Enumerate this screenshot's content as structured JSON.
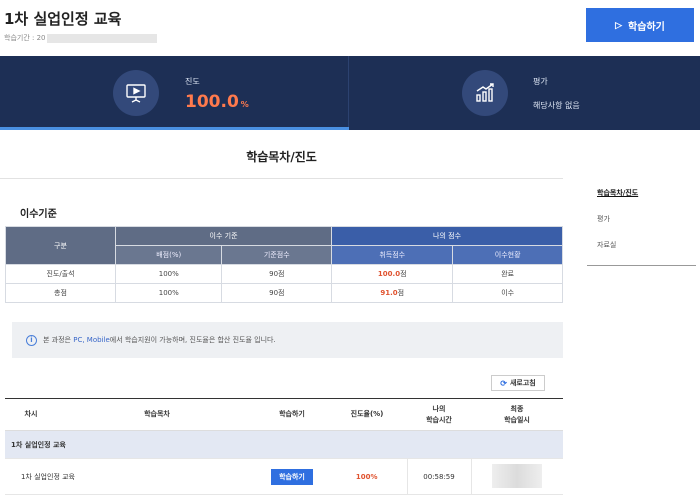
{
  "header": {
    "title": "1차 실업인정 교육",
    "period_label": "학습기간 : 20",
    "start_button": "학습하기"
  },
  "stats": {
    "progress_label": "진도",
    "progress_value": "100.0",
    "progress_unit": "%",
    "grade_label": "평가",
    "grade_value": "해당사항 없음"
  },
  "main": {
    "title": "학습목차/진도",
    "section_title": "이수기준"
  },
  "side_menu": [
    {
      "label": "학습목차/진도",
      "active": true
    },
    {
      "label": "평가",
      "active": false
    },
    {
      "label": "자료실",
      "active": false
    }
  ],
  "criteria": {
    "col_group": "구분",
    "group_standard": "이수 기준",
    "group_mine": "나의 점수",
    "sub_weight": "배점(%)",
    "sub_base": "기준점수",
    "sub_acquired": "취득점수",
    "sub_status": "이수현황",
    "rows": [
      {
        "name": "진도/출석",
        "weight": "100%",
        "base": "90점",
        "acquired_num": "100.0",
        "acquired_unit": "점",
        "status": "완료"
      },
      {
        "name": "총점",
        "weight": "100%",
        "base": "90점",
        "acquired_num": "91.0",
        "acquired_unit": "점",
        "status": "이수"
      }
    ]
  },
  "notice": {
    "prefix": "본 과정은 ",
    "highlight": "PC, Mobile",
    "suffix": " 에서 학습지원이 가능하며, 진도율은 합산 진도율 입니다."
  },
  "refresh_label": "새로고침",
  "list": {
    "headers": [
      "차시",
      "학습목차",
      "학습하기",
      "진도율(%)",
      "나의 학습시간",
      "최종 학습일시"
    ],
    "header_my_time_1": "나의",
    "header_my_time_2": "학습시간",
    "header_last_1": "최종",
    "header_last_2": "학습일시",
    "group_title": "1차 실업인정 교육",
    "rows": [
      {
        "title": "1차 실업인정 교육",
        "button": "학습하기",
        "progress": "100%",
        "time": "00:58:59"
      }
    ]
  },
  "colors": {
    "primary_blue": "#2f6fe0",
    "stats_bg": "#1d2f55",
    "accent_orange": "#ff7a4d"
  }
}
